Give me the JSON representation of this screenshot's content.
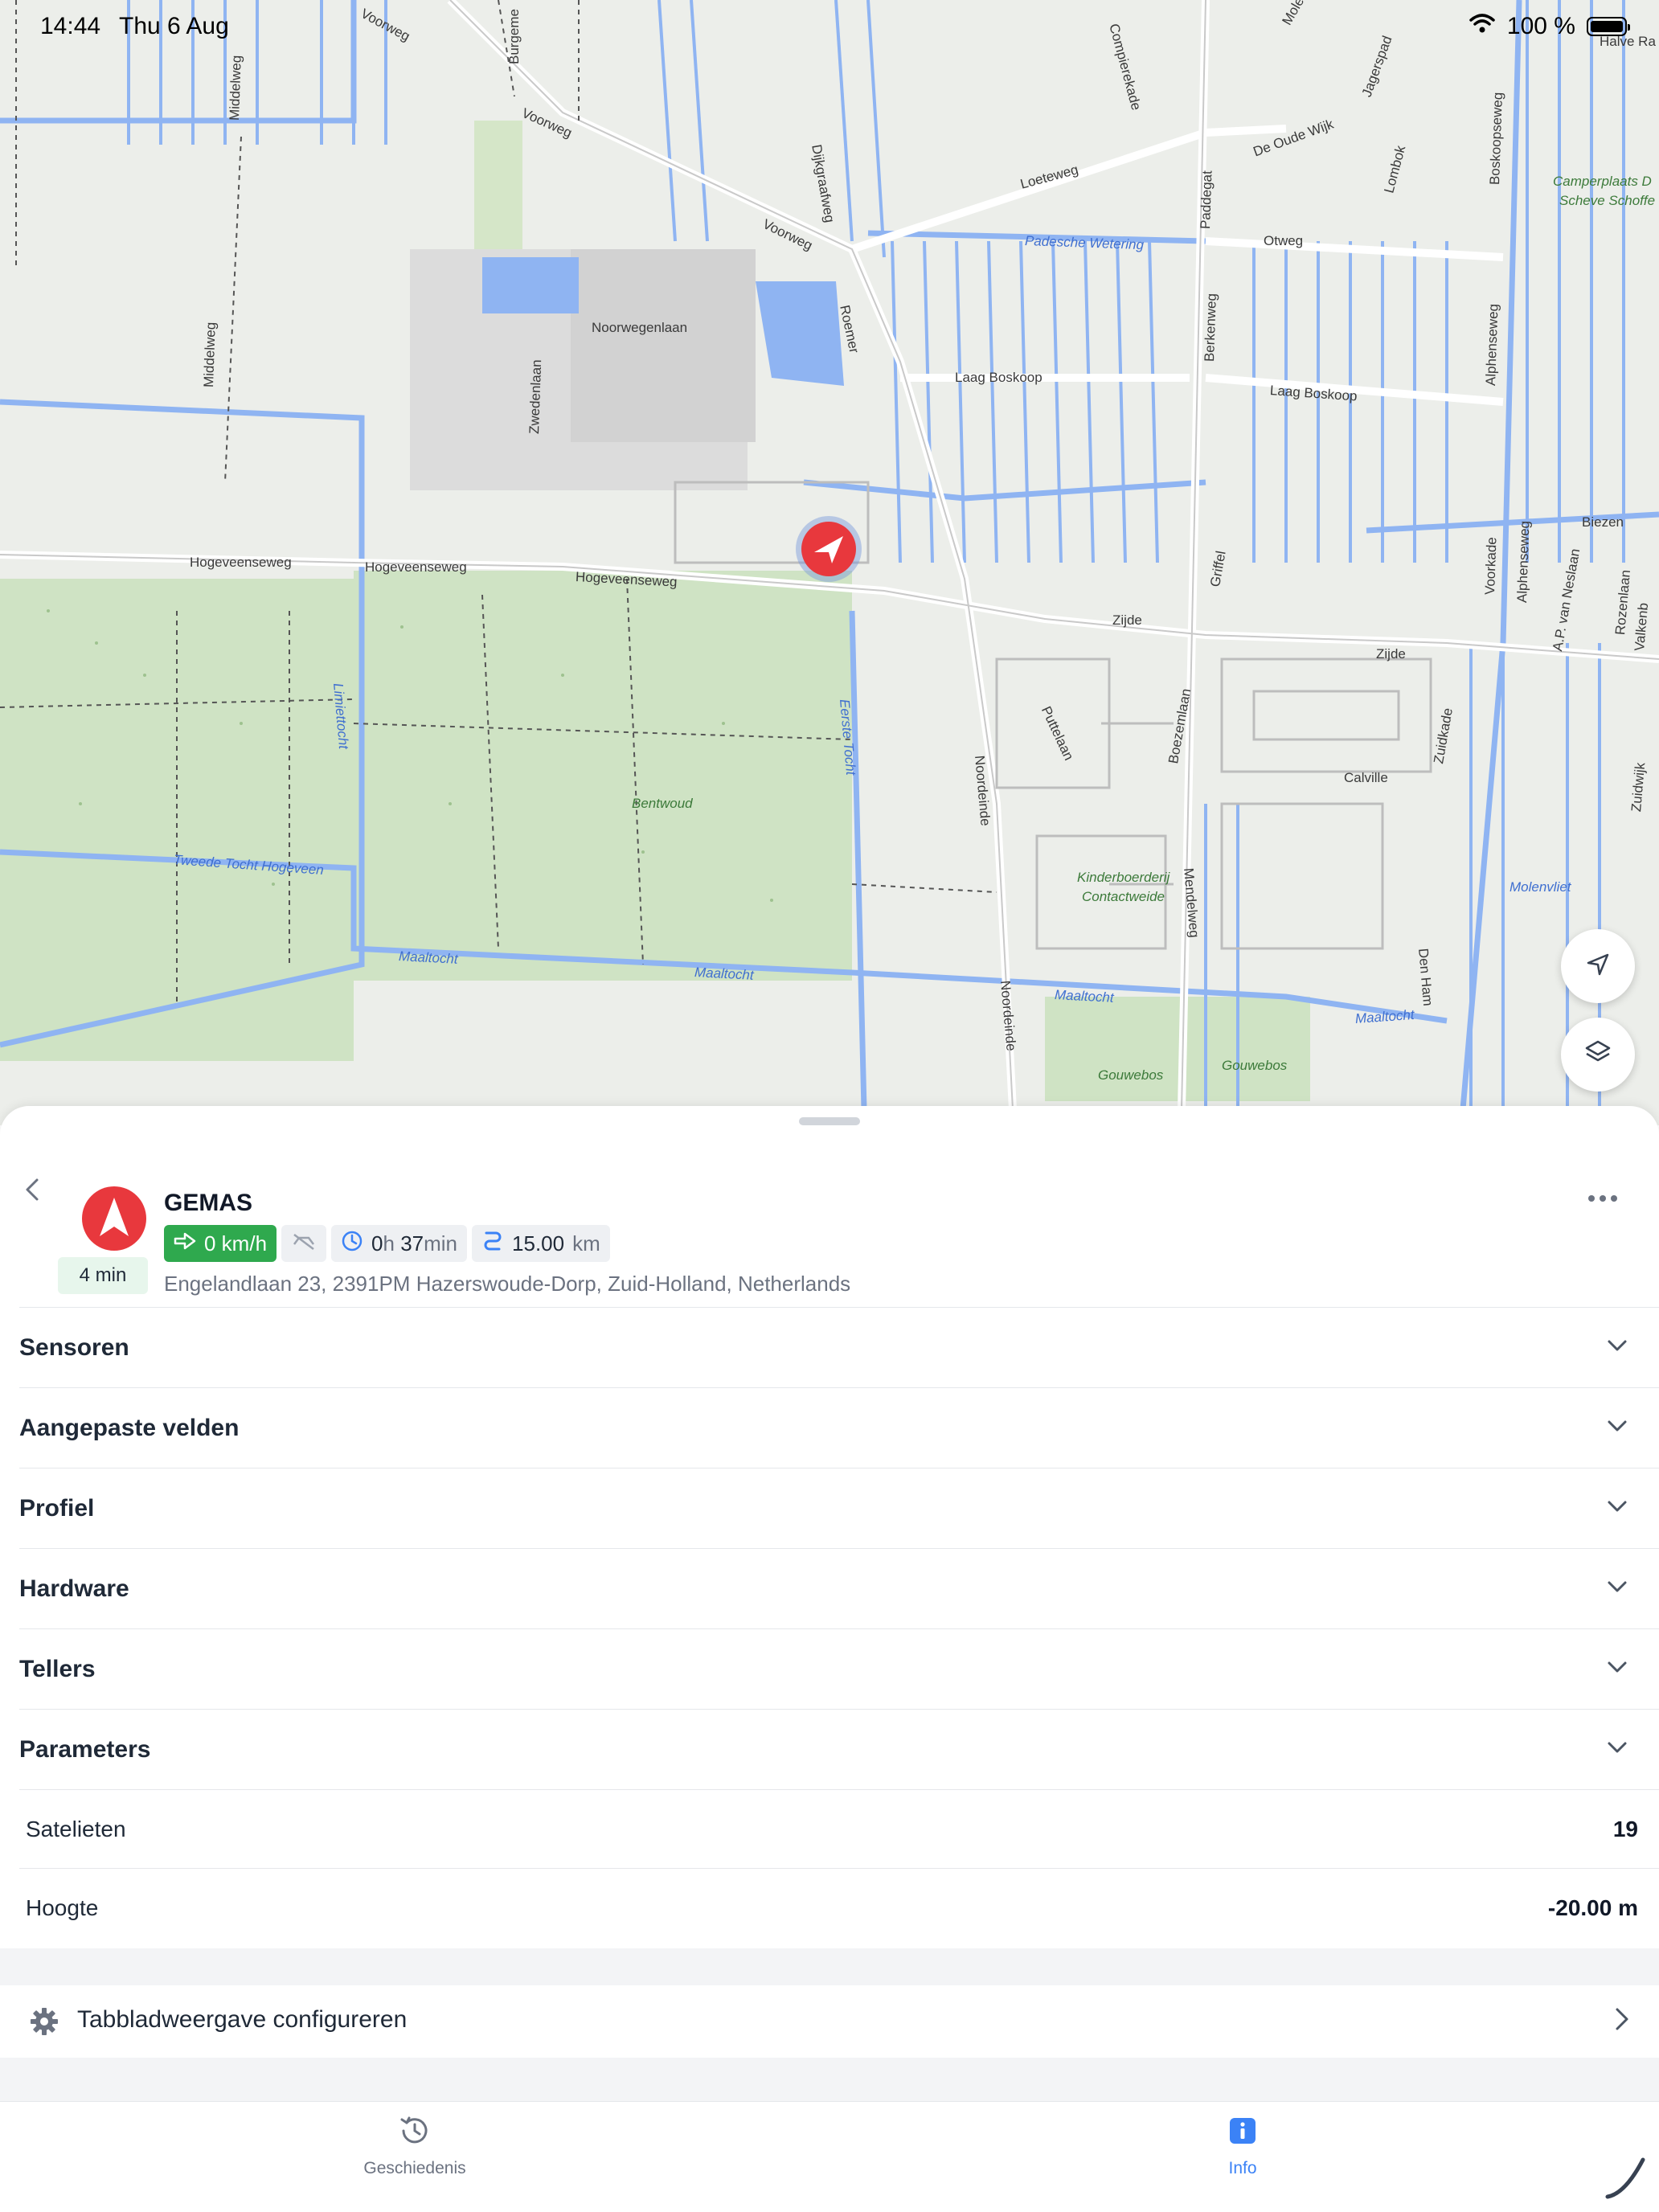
{
  "status_bar": {
    "time": "14:44",
    "date": "Thu 6 Aug",
    "battery": "100 %"
  },
  "map": {
    "labels": {
      "voorweg1": "Voorweg",
      "voorweg2": "Voorweg",
      "voorweg3": "Voorweg",
      "burgeme": "Burgeme",
      "middelweg1": "Middelweg",
      "middelweg2": "Middelweg",
      "dijkgraafweg": "Dijkgraafweg",
      "compierekade": "Compierekade",
      "molen": "Molen",
      "halve_ra": "Halve Ra",
      "jagerspad": "Jagerspad",
      "de_oude_wijk": "De Oude Wijk",
      "lombok": "Lombok",
      "loeteweg": "Loeteweg",
      "paddegat": "Paddegat",
      "boskoopseweg": "Boskoopseweg",
      "camperplaats": "Camperplaats D",
      "scheve_schoffe": "Scheve Schoffe",
      "padesche_wetering": "Padesche Wetering",
      "otweg": "Otweg",
      "noorwegenlaan": "Noorwegenlaan",
      "roemer": "Roemer",
      "berkenweg": "Berkenweg",
      "alphenseweg1": "Alphenseweg",
      "laag_boskoop1": "Laag Boskoop",
      "laag_boskoop2": "Laag Boskoop",
      "zwedenlaan": "Zwedenlaan",
      "biezen": "Biezen",
      "hogeveenseweg1": "Hogeveenseweg",
      "hogeveenseweg2": "Hogeveenseweg",
      "hogeveenseweg3": "Hogeveenseweg",
      "griffel": "Griffel",
      "voorkade": "Voorkade",
      "alphenseweg2": "Alphenseweg",
      "ap_van_neslaan": "A.P. van Neslaan",
      "rozenlaan": "Rozenlaan",
      "valkenb": "Valkenb",
      "zijde1": "Zijde",
      "zijde2": "Zijde",
      "limiettocht": "Limiettocht",
      "eerste_tocht": "Eerste Tocht",
      "puttelaan": "Puttelaan",
      "boezemlaan": "Boezemlaan",
      "zuidkade": "Zuidkade",
      "noordeinde1": "Noordeinde",
      "noordeinde2": "Noordeinde",
      "bentwoud": "Bentwoud",
      "calville": "Calville",
      "zuidwijk": "Zuidwijk",
      "tweede_tocht": "Tweede Tocht Hogeveen",
      "kinderboerderij": "Kinderboerderij",
      "contactweide": "Contactweide",
      "mendelweg": "Mendelweg",
      "molenvliet": "Molenvliet",
      "den_ham": "Den Ham",
      "maaltocht1": "Maaltocht",
      "maaltocht2": "Maaltocht",
      "maaltocht3": "Maaltocht",
      "maaltocht4": "Maaltocht",
      "gouwebos1": "Gouwebos",
      "gouwebos2": "Gouwebos"
    },
    "buttons": {
      "locate_icon": "navigation-arrow-icon",
      "layers_icon": "layers-icon"
    }
  },
  "device": {
    "name": "GEMAS",
    "time_badge": "4 min",
    "speed": "0 km/h",
    "duration_h": "0",
    "duration_h_unit": "h",
    "duration_m": "37",
    "duration_m_unit": "min",
    "distance": "15.00",
    "distance_unit": "km",
    "address": "Engelandlaan 23, 2391PM Hazerswoude-Dorp, Zuid-Holland, Netherlands"
  },
  "sections": [
    {
      "label": "Sensoren"
    },
    {
      "label": "Aangepaste velden"
    },
    {
      "label": "Profiel"
    },
    {
      "label": "Hardware"
    },
    {
      "label": "Tellers"
    },
    {
      "label": "Parameters"
    }
  ],
  "values": [
    {
      "label": "Satelieten",
      "value": "19"
    },
    {
      "label": "Hoogte",
      "value": "-20.00 m"
    }
  ],
  "config": {
    "label": "Tabbladweergave configureren"
  },
  "tabs": [
    {
      "label": "Geschiedenis",
      "icon": "history-icon",
      "active": false
    },
    {
      "label": "Info",
      "icon": "info-icon",
      "active": true
    }
  ],
  "colors": {
    "accent": "#3b82f6",
    "marker": "#e8383d",
    "speed_chip": "#2fa94e",
    "water": "#8fb4f2",
    "park": "#cfe3c4"
  }
}
